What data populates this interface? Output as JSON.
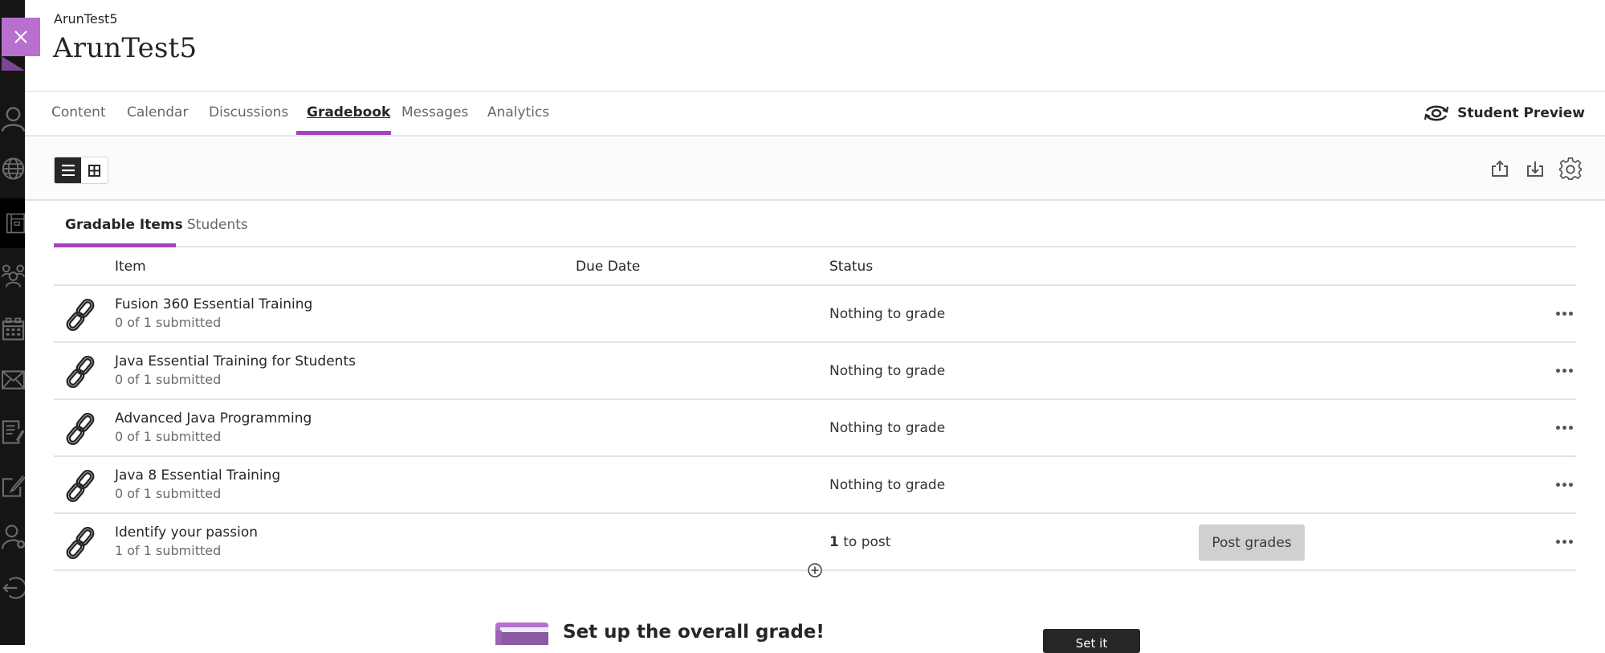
{
  "sidebar": {
    "close_icon": "close-icon",
    "items": [
      {
        "icon": "profile-icon",
        "active": false
      },
      {
        "icon": "globe-icon",
        "active": false
      },
      {
        "icon": "courses-icon",
        "active": true
      },
      {
        "icon": "groups-icon",
        "active": false
      },
      {
        "icon": "calendar-icon",
        "active": false
      },
      {
        "icon": "messages-icon",
        "active": false
      },
      {
        "icon": "grades-icon",
        "active": false
      },
      {
        "icon": "edit-icon",
        "active": false
      },
      {
        "icon": "user-settings-icon",
        "active": false
      },
      {
        "icon": "sign-out-icon",
        "active": false
      }
    ]
  },
  "header": {
    "course_small": "ArunTest5",
    "course_title": "ArunTest5"
  },
  "nav": {
    "tabs": [
      {
        "label": "Content"
      },
      {
        "label": "Calendar"
      },
      {
        "label": "Discussions"
      },
      {
        "label": "Gradebook",
        "active": true
      },
      {
        "label": "Messages"
      },
      {
        "label": "Analytics"
      }
    ],
    "student_preview": "Student Preview"
  },
  "toolbar": {
    "view_list_icon": "list-view-icon",
    "view_grid_icon": "grid-view-icon",
    "upload_icon": "upload-icon",
    "download_icon": "download-icon",
    "settings_icon": "gear-icon"
  },
  "subtabs": [
    {
      "label": "Gradable Items",
      "active": true
    },
    {
      "label": "Students"
    }
  ],
  "table": {
    "columns": [
      "Item",
      "Due Date",
      "Status"
    ],
    "rows": [
      {
        "name": "Fusion 360 Essential Training",
        "submitted": "0 of 1 submitted",
        "due": "",
        "status": "Nothing to grade"
      },
      {
        "name": "Java Essential Training for Students",
        "submitted": "0 of 1 submitted",
        "due": "",
        "status": "Nothing to grade"
      },
      {
        "name": "Advanced Java Programming",
        "submitted": "0 of 1 submitted",
        "due": "",
        "status": "Nothing to grade"
      },
      {
        "name": "Java 8 Essential Training",
        "submitted": "0 of 1 submitted",
        "due": "",
        "status": "Nothing to grade"
      },
      {
        "name": "Identify your passion",
        "submitted": "1 of 1 submitted",
        "due": "",
        "status_count": "1",
        "status_text": "to post",
        "action": "Post grades"
      }
    ]
  },
  "banner": {
    "text": "Set up the overall grade!",
    "button": "Set it"
  },
  "colors": {
    "accent": "#a544be",
    "close_tab": "#b86fce",
    "sidebar_bg": "#151515",
    "post_button": "#d0d0d0"
  }
}
